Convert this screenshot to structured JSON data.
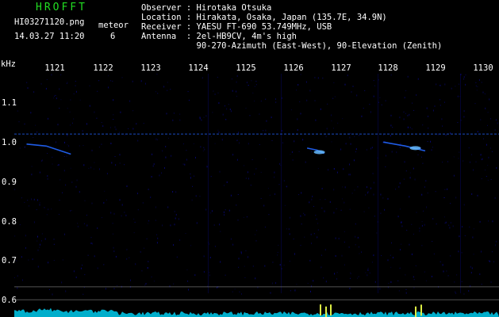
{
  "header": {
    "app_title": "HROFFT",
    "filename": "HI03271120.png",
    "datetime": "14.03.27 11:20",
    "meteor_label": "meteor",
    "meteor_count": "6"
  },
  "station": {
    "observer": "Observer : Hirotaka Otsuka",
    "location": "Location : Hirakata, Osaka, Japan (135.7E, 34.9N)",
    "receiver": "Receiver : YAESU FT-690 53.749MHz, USB",
    "antenna": "Antenna  : 2el-HB9CV, 4m's high",
    "antenna_detail": "           90-270-Azimuth (East-West), 90-Elevation (Zenith)"
  },
  "chart_data": {
    "type": "heatmap",
    "title": "",
    "xlabel": "",
    "ylabel": "kHz",
    "x_ticks": [
      "1121",
      "1122",
      "1123",
      "1124",
      "1125",
      "1126",
      "1127",
      "1128",
      "1129",
      "1130"
    ],
    "y_ticks": [
      "1.1",
      "1.0",
      "0.9",
      "0.8",
      "0.7",
      "0.6"
    ],
    "xlim": [
      1120.35,
      1130.2
    ],
    "ylim": [
      0.575,
      1.18
    ],
    "colors": {
      "background": "#000000",
      "noise": "#0a0a88",
      "trace": "#2266ff",
      "head_echo": "#66bbff",
      "spectrum": "#00ccee",
      "spectrum_peak": "#ddee44"
    },
    "carrier_lines_khz": [
      1.03,
      0.65,
      0.618
    ],
    "echo_traces": [
      {
        "x": [
          1120.6,
          1121.0,
          1121.5
        ],
        "y": [
          1.005,
          1.0,
          0.98
        ]
      },
      {
        "x": [
          1126.3,
          1126.5,
          1126.65
        ],
        "y": [
          0.995,
          0.99,
          0.982
        ]
      },
      {
        "x": [
          1127.85,
          1128.3,
          1128.7
        ],
        "y": [
          1.01,
          1.0,
          0.988
        ]
      }
    ],
    "head_echoes": [
      {
        "x": 1126.55,
        "y": 0.985
      },
      {
        "x": 1128.5,
        "y": 0.995
      }
    ]
  }
}
